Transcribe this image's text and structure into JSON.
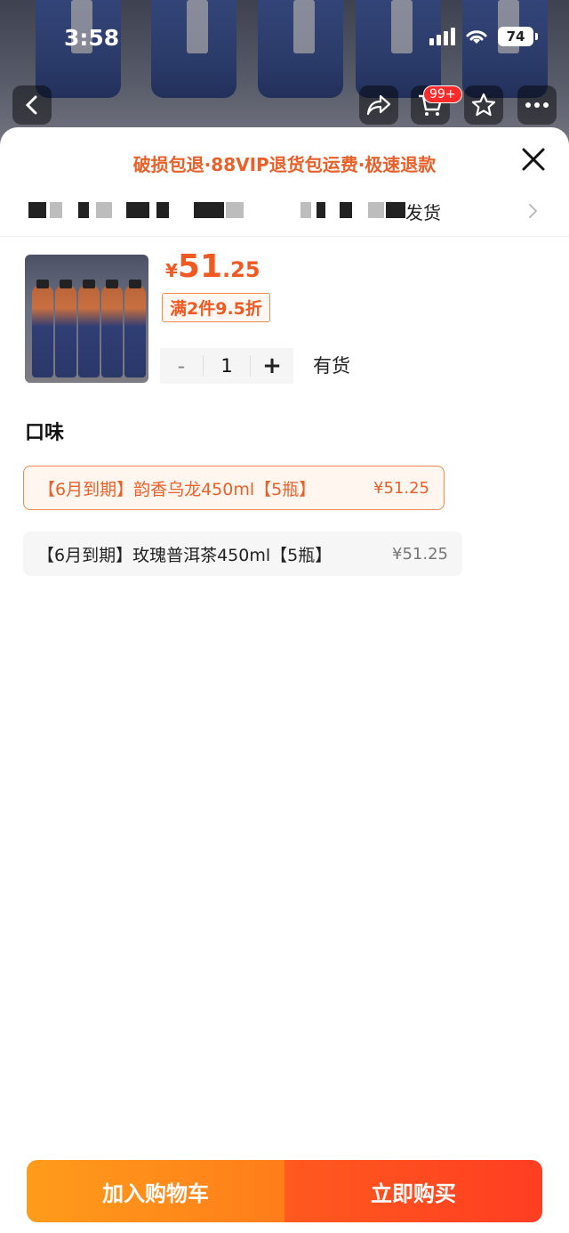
{
  "status_bar": {
    "time": "3:58",
    "battery": "74"
  },
  "top_nav": {
    "cart_badge": "99+"
  },
  "sheet": {
    "promo_text": "破损包退·88VIP退货包运费·极速退款",
    "address_suffix": "发货",
    "product": {
      "price_symbol": "¥",
      "price_int": "51",
      "price_dec": ".25",
      "discount": "满2件9.5折",
      "quantity": "1",
      "minus_label": "-",
      "plus_label": "+",
      "stock": "有货"
    },
    "option_group_title": "口味",
    "options": [
      {
        "label": "【6月到期】韵香乌龙450ml【5瓶】",
        "price": "¥51.25",
        "selected": true
      },
      {
        "label": "【6月到期】玫瑰普洱茶450ml【5瓶】",
        "price": "¥51.25",
        "selected": false
      }
    ]
  },
  "actions": {
    "add_to_cart": "加入购物车",
    "buy_now": "立即购买"
  },
  "colors": {
    "accent": "#f05a22",
    "cart_button": "#ff8c1a",
    "buy_button": "#ff4a20"
  }
}
